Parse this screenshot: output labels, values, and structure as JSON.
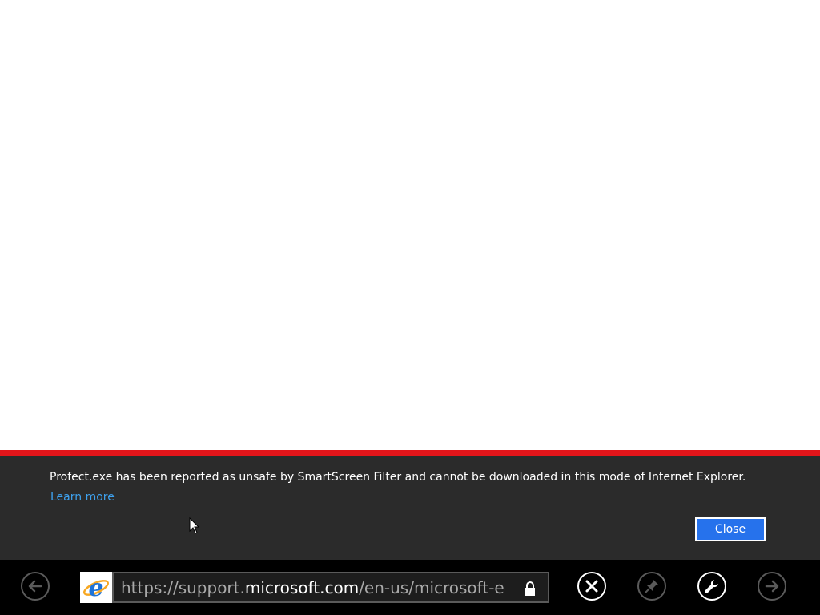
{
  "notification": {
    "message": "Profect.exe has been reported as unsafe by SmartScreen Filter and cannot be downloaded in this mode of Internet Explorer.",
    "learn_more": "Learn more",
    "close_label": "Close",
    "accent_color": "#e3151a"
  },
  "address_bar": {
    "url_scheme": "https://",
    "url_subdomain": "support.",
    "url_host": "microsoft.com",
    "url_path": "/en-us/microsoft-edge",
    "secure_icon": "lock-icon",
    "site_icon": "internet-explorer-icon"
  },
  "appbar": {
    "buttons": [
      "back-icon",
      "stop-icon",
      "pin-icon",
      "tools-icon",
      "forward-icon"
    ]
  }
}
